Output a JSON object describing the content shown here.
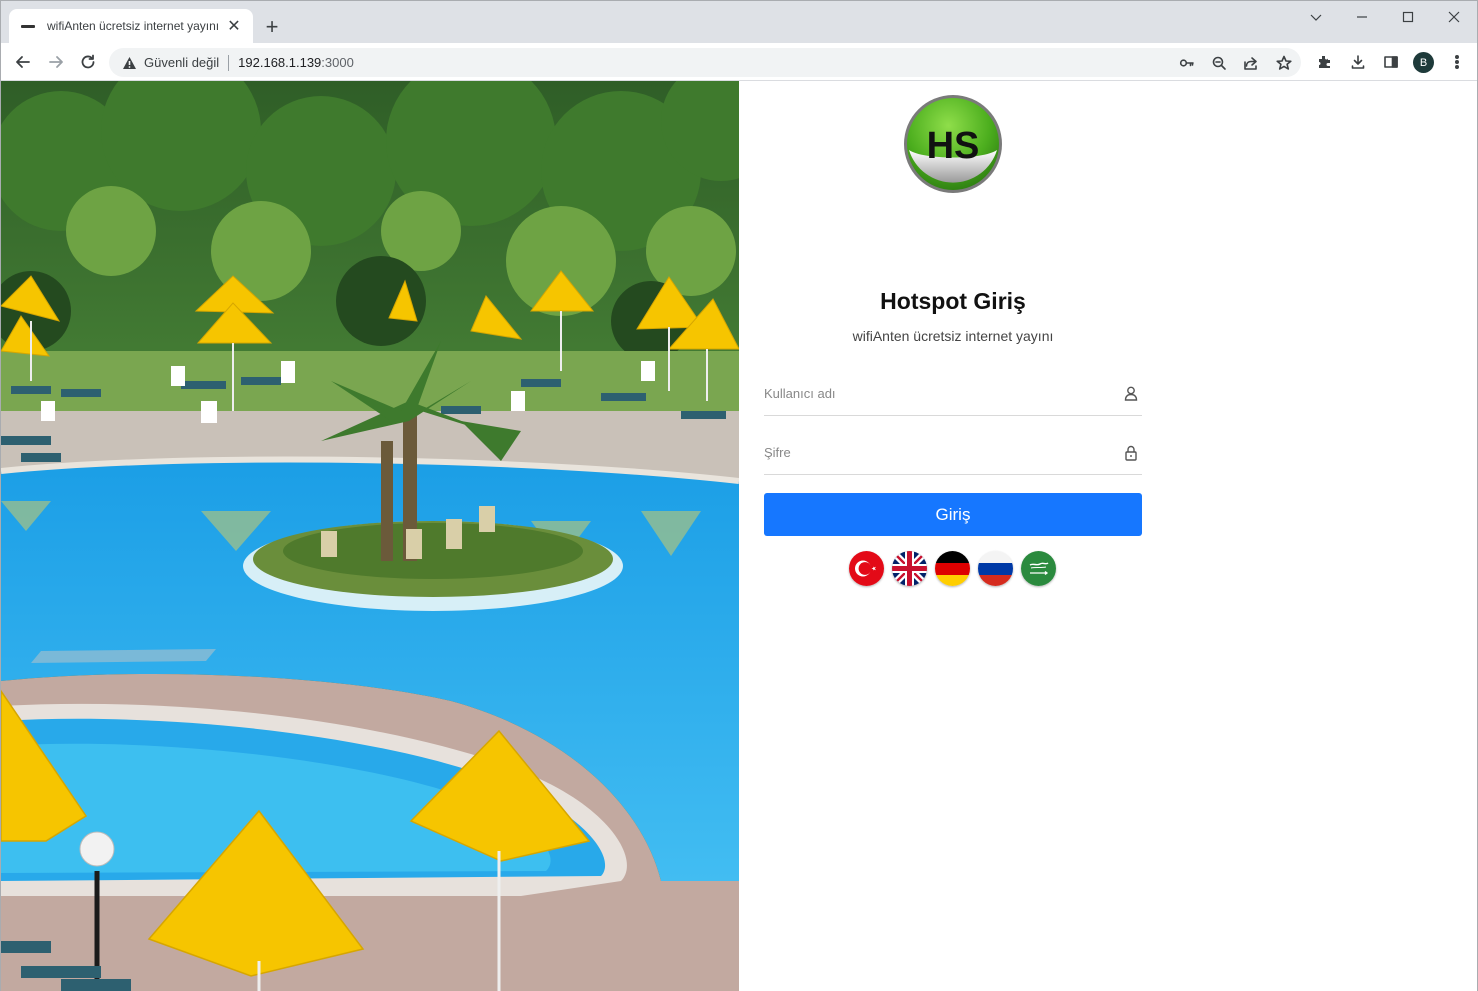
{
  "browser": {
    "tab": {
      "title": "wifiAnten ücretsiz internet yayını",
      "close": "✕"
    },
    "new_tab": "+",
    "address_bar": {
      "security_label": "Güvenli değil",
      "url_host": "192.168.1.139",
      "url_port": ":3000"
    },
    "profile_initial": "B"
  },
  "login": {
    "logo_text": "HS",
    "title": "Hotspot Giriş",
    "subtitle": "wifiAnten ücretsiz internet yayını",
    "username_placeholder": "Kullanıcı adı",
    "password_placeholder": "Şifre",
    "submit_label": "Giriş",
    "languages": [
      {
        "code": "tr",
        "icon": "turkey-flag-icon"
      },
      {
        "code": "en",
        "icon": "uk-flag-icon"
      },
      {
        "code": "de",
        "icon": "germany-flag-icon"
      },
      {
        "code": "ru",
        "icon": "russia-flag-icon"
      },
      {
        "code": "ar",
        "icon": "saudi-arabia-flag-icon"
      }
    ]
  },
  "colors": {
    "primary_button": "#1677ff",
    "logo_green": "#4cae1e"
  }
}
